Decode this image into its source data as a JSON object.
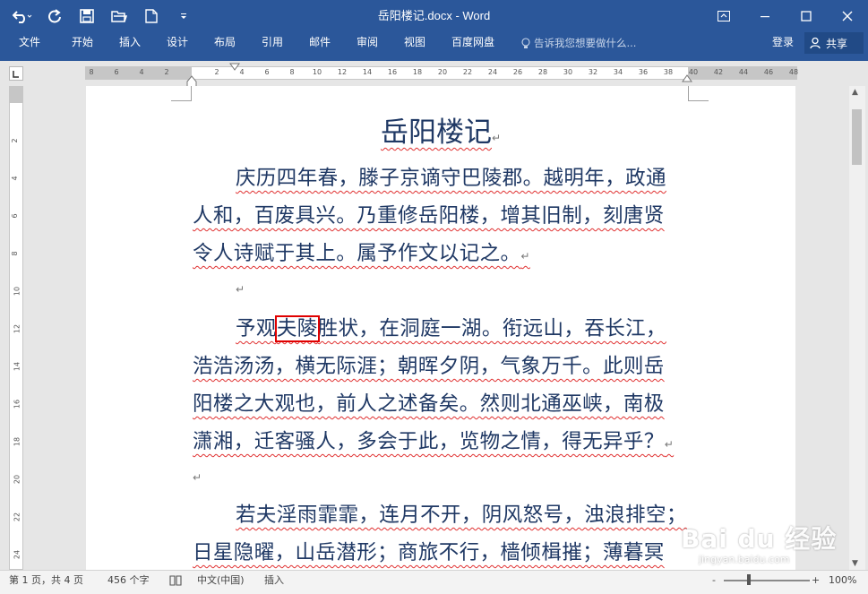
{
  "window": {
    "title": "岳阳楼记.docx - Word"
  },
  "ribbon": {
    "tabs": [
      "文件",
      "开始",
      "插入",
      "设计",
      "布局",
      "引用",
      "邮件",
      "审阅",
      "视图",
      "百度网盘"
    ],
    "tell_me": "告诉我您想要做什么...",
    "login": "登录",
    "share": "共享"
  },
  "ruler": {
    "h_numbers": [
      "8",
      "6",
      "4",
      "2",
      "2",
      "4",
      "6",
      "8",
      "10",
      "12",
      "14",
      "16",
      "18",
      "20",
      "22",
      "24",
      "26",
      "28",
      "30",
      "32",
      "34",
      "36",
      "38",
      "40",
      "42",
      "44",
      "46",
      "48"
    ],
    "v_numbers": [
      "2",
      "4",
      "6",
      "8",
      "10",
      "12",
      "14",
      "16",
      "18",
      "20",
      "22",
      "24"
    ]
  },
  "document": {
    "title": "岳阳楼记",
    "para1": [
      "庆历四年春，滕子京谪守巴陵郡。越明年，政通",
      "人和，百废具兴。乃重修岳阳楼，增其旧制，刻唐贤",
      "令人诗赋于其上。属予作文以记之。"
    ],
    "para2_line1": {
      "before": "予观",
      "highlight": "夫陵",
      "after": "胜状，在洞庭一湖。衔远山，吞长江，"
    },
    "para2": [
      "浩浩汤汤，横无际涯；朝晖夕阴，气象万千。此则岳",
      "阳楼之大观也，前人之述备矣。然则北通巫峡，南极",
      "潇湘，迁客骚人，多会于此，览物之情，得无异乎？"
    ],
    "para3": [
      "若夫淫雨霏霏，连月不开，阴风怒号，浊浪排空；",
      "日星隐曜，山岳潜形；商旅不行，樯倾楫摧；薄暮冥"
    ],
    "para_mark": "↵"
  },
  "statusbar": {
    "page": "第 1 页，共 4 页",
    "words": "456 个字",
    "language": "中文(中国)",
    "mode": "插入",
    "zoom": "100%",
    "minus": "-",
    "plus": "+"
  },
  "watermark": {
    "brand": "Bai du 经验",
    "url": "jingyan.baidu.com"
  },
  "colors": {
    "accent": "#2b579a",
    "text": "#1f3864",
    "highlight_box": "#e00000",
    "spell_underline": "#e03030"
  }
}
